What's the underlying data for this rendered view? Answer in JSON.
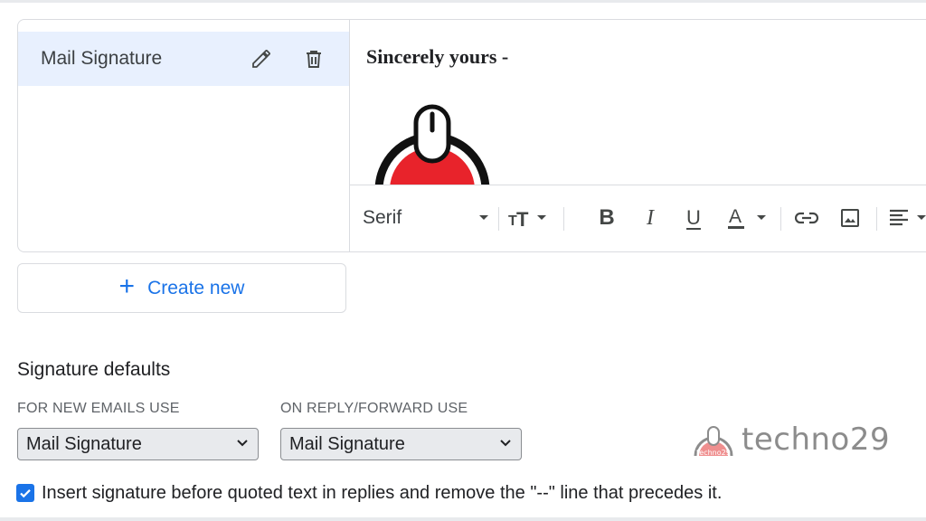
{
  "signatures": {
    "items": [
      {
        "label": "Mail Signature",
        "edit_icon": "pencil-icon",
        "delete_icon": "trash-icon"
      }
    ]
  },
  "editor": {
    "content_text": "Sincerely yours -",
    "logo_icon": "power-mouse-logo",
    "toolbar": {
      "font": "Serif",
      "size_icon": "text-size-icon",
      "bold": "B",
      "italic": "I",
      "underline": "U",
      "text_color": "A",
      "link_icon": "link-icon",
      "image_icon": "image-icon",
      "align_icon": "align-left-icon"
    }
  },
  "create_new": {
    "label": "Create new",
    "icon": "plus-icon"
  },
  "defaults": {
    "title": "Signature defaults",
    "new_emails": {
      "label": "FOR NEW EMAILS USE",
      "value": "Mail Signature"
    },
    "reply_forward": {
      "label": "ON REPLY/FORWARD USE",
      "value": "Mail Signature"
    },
    "insert_before_quoted": {
      "checked": true,
      "label": "Insert signature before quoted text in replies and remove the \"--\" line that precedes it."
    }
  },
  "watermark": {
    "text": "techno29",
    "logo_text": "techno29"
  },
  "colors": {
    "accent": "#1a73e8",
    "selected_row": "#e8f0fe",
    "logo_red": "#e8232b",
    "border": "#dadce0"
  }
}
